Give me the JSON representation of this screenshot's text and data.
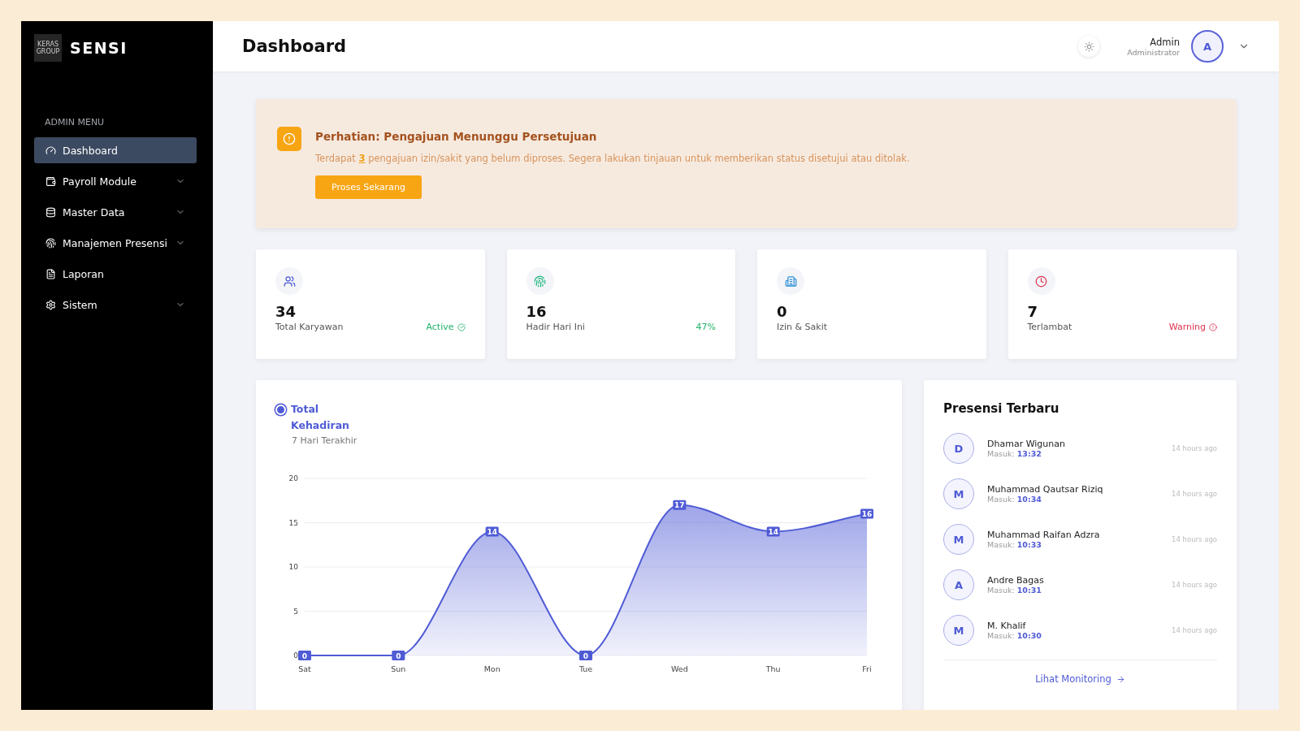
{
  "sidebar": {
    "logo_badge": "KERAS GROUP",
    "brand": "SENSI",
    "section_label": "ADMIN MENU",
    "items": [
      {
        "label": "Dashboard",
        "kind": "link",
        "selected": true
      },
      {
        "label": "Payroll Module",
        "kind": "group",
        "selected": false
      },
      {
        "label": "Master Data",
        "kind": "group",
        "selected": false
      },
      {
        "label": "Manajemen Presensi",
        "kind": "group",
        "selected": false
      },
      {
        "label": "Laporan",
        "kind": "link",
        "selected": false
      },
      {
        "label": "Sistem",
        "kind": "group",
        "selected": false
      }
    ]
  },
  "header": {
    "title": "Dashboard",
    "user_name": "Admin",
    "user_role": "Administrator",
    "avatar_initial": "A"
  },
  "alert": {
    "title": "Perhatian: Pengajuan Menunggu Persetujuan",
    "message": "Terdapat **3** pengajuan izin/sakit yang belum diproses. Segera lakukan tinjauan untuk memberikan status disetujui atau ditolak.",
    "button": "Proses Sekarang"
  },
  "stats": [
    {
      "value": "34",
      "label": "Total Karyawan",
      "status": "Active",
      "kind": "active"
    },
    {
      "value": "16",
      "label": "Hadir Hari Ini",
      "status": "47%",
      "kind": "percent"
    },
    {
      "value": "0",
      "label": "Izin & Sakit",
      "kind": "plain"
    },
    {
      "value": "7",
      "label": "Terlambat",
      "status": "Warning",
      "kind": "warning"
    }
  ],
  "chart": {
    "subtitle": "7 Hari Terakhir",
    "chart_data": {
      "type": "area",
      "categories": [
        "Sat",
        "Sun",
        "Mon",
        "Tue",
        "Wed",
        "Thu",
        "Fri"
      ],
      "series": [
        {
          "name": "Total Kehadiran",
          "color": "#4f5bd5",
          "values": [
            0,
            0,
            14,
            0,
            17,
            14,
            16
          ]
        }
      ],
      "ylim": [
        0,
        20
      ],
      "yticks": [
        0,
        5,
        10,
        15,
        20
      ],
      "grid": true,
      "data_labels": true
    }
  },
  "recent": {
    "title": "Presensi Terbaru",
    "items": [
      {
        "initial": "D",
        "name": "Dhamar Wigunan",
        "label": "Masuk:",
        "time": "13:32",
        "ago": "14 hours ago"
      },
      {
        "initial": "M",
        "name": "Muhammad Qautsar Riziq",
        "label": "Masuk:",
        "time": "10:34",
        "ago": "14 hours ago"
      },
      {
        "initial": "M",
        "name": "Muhammad Raifan Adzra",
        "label": "Masuk:",
        "time": "10:33",
        "ago": "14 hours ago"
      },
      {
        "initial": "A",
        "name": "Andre Bagas",
        "label": "Masuk:",
        "time": "10:31",
        "ago": "14 hours ago"
      },
      {
        "initial": "M",
        "name": "M. Khalif",
        "label": "Masuk:",
        "time": "10:30",
        "ago": "14 hours ago"
      }
    ],
    "link": "Lihat Monitoring"
  }
}
